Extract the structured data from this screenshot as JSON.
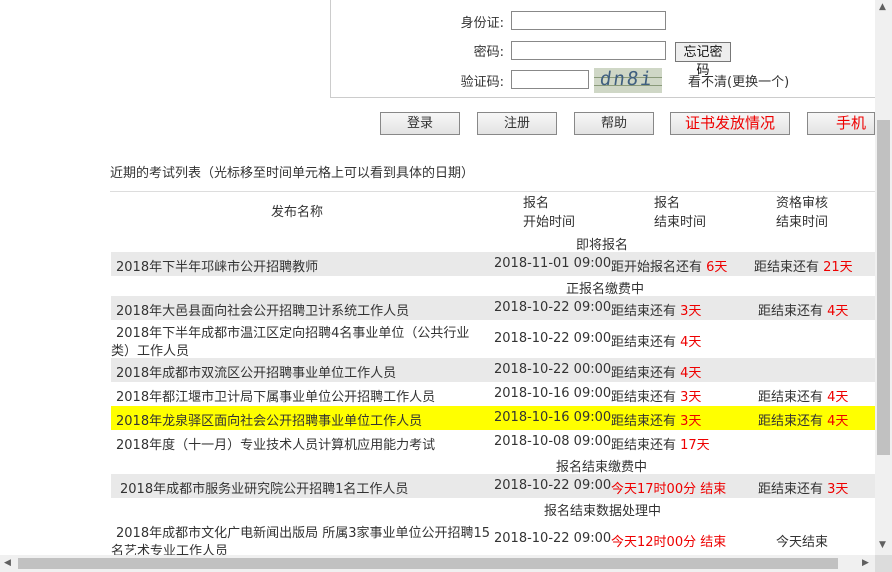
{
  "login": {
    "id_label": "身份证:",
    "password_label": "密码:",
    "forgot_label": "忘记密码",
    "captcha_label": "验证码:",
    "captcha_text": "dn8i",
    "refresh_text": "看不清(更换一个)"
  },
  "buttons": {
    "login": "登录",
    "register": "注册",
    "help": "帮助",
    "cert": "证书发放情况",
    "mobile": "手机报"
  },
  "list_caption": "近期的考试列表（光标移至时间单元格上可以看到具体的日期）",
  "table": {
    "headers": {
      "name": "发布名称",
      "start": [
        "报名",
        "开始时间"
      ],
      "end": [
        "报名",
        "结束时间"
      ],
      "review": [
        "资格审核",
        "结束时间"
      ]
    },
    "sections": {
      "upcoming": "即将报名",
      "open": "正报名缴费中",
      "fee": "报名结束缴费中",
      "processing": "报名结束数据处理中"
    },
    "rows": [
      {
        "name": "2018年下半年邛崃市公开招聘教师",
        "start": "2018-11-01 09:00",
        "end_prefix": "距开始报名还有 ",
        "end_red": "6天",
        "review_prefix": "距结束还有 ",
        "review_red": "21天"
      },
      {
        "name": "2018年大邑县面向社会公开招聘卫计系统工作人员",
        "start": "2018-10-22 09:00",
        "end_prefix": "距结束还有 ",
        "end_red": "3天",
        "review_prefix": "距结束还有 ",
        "review_red": "4天"
      },
      {
        "name": "2018年下半年成都市温江区定向招聘4名事业单位（公共行业",
        "name2": "类）工作人员",
        "start": "2018-10-22 09:00",
        "end_prefix": "距结束还有 ",
        "end_red": "4天",
        "review_prefix": "",
        "review_red": ""
      },
      {
        "name": "2018年成都市双流区公开招聘事业单位工作人员",
        "start": "2018-10-22 00:00",
        "end_prefix": "距结束还有 ",
        "end_red": "4天",
        "review_prefix": "",
        "review_red": ""
      },
      {
        "name": "2018年都江堰市卫计局下属事业单位公开招聘工作人员",
        "start": "2018-10-16 09:00",
        "end_prefix": "距结束还有 ",
        "end_red": "3天",
        "review_prefix": "距结束还有 ",
        "review_red": "4天"
      },
      {
        "name": "2018年龙泉驿区面向社会公开招聘事业单位工作人员",
        "start": "2018-10-16 09:00",
        "end_prefix": "距结束还有 ",
        "end_red": "3天",
        "review_prefix": "距结束还有 ",
        "review_red": "4天"
      },
      {
        "name": "2018年度（十一月）专业技术人员计算机应用能力考试",
        "start": "2018-10-08 09:00",
        "end_prefix": "距结束还有 ",
        "end_red": "17天",
        "review_prefix": "",
        "review_red": ""
      },
      {
        "name": "2018年成都市服务业研究院公开招聘1名工作人员",
        "start": "2018-10-22 09:00",
        "end_prefix": "",
        "end_red": "今天17时00分 结束",
        "review_prefix": "距结束还有 ",
        "review_red": "3天"
      },
      {
        "name": "2018年成都市文化广电新闻出版局 所属3家事业单位公开招聘15",
        "name2": "名艺术专业工作人员",
        "start": "2018-10-22 09:00",
        "end_prefix": "",
        "end_red": "今天12时00分 结束",
        "review_prefix": "今天结束",
        "review_red": ""
      }
    ]
  },
  "colors": {
    "highlight": "#ffff00",
    "alert_red": "#ee0000",
    "row_gray": "#e9e9e9"
  }
}
